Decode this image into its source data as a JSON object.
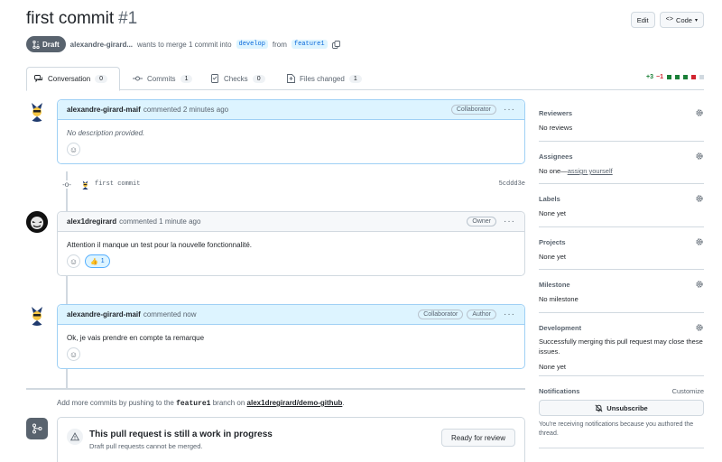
{
  "header": {
    "title": "first commit",
    "number": "#1",
    "edit_label": "Edit",
    "code_label": "Code"
  },
  "subtitle": {
    "badge": "Draft",
    "author": "alexandre-girard...",
    "text_merge": "wants to merge 1 commit into",
    "base_branch": "develop",
    "text_from": "from",
    "head_branch": "feature1"
  },
  "tabs": [
    {
      "label": "Conversation",
      "count": "0"
    },
    {
      "label": "Commits",
      "count": "1"
    },
    {
      "label": "Checks",
      "count": "0"
    },
    {
      "label": "Files changed",
      "count": "1"
    }
  ],
  "diffstat": {
    "additions": "+3",
    "deletions": "−1"
  },
  "comments": [
    {
      "author": "alexandre-girard-maif",
      "time": "commented 2 minutes ago",
      "role": "Collaborator",
      "body": "No description provided."
    },
    {
      "author": "alex1dregirard",
      "time": "commented 1 minute ago",
      "role": "Owner",
      "body": "Attention il manque un test pour la nouvelle fonctionnalité.",
      "reaction_count": "1"
    },
    {
      "author": "alexandre-girard-maif",
      "time": "commented now",
      "role": "Collaborator",
      "role2": "Author",
      "body": "Ok, je vais prendre en compte ta remarque"
    }
  ],
  "commit": {
    "message": "first commit",
    "sha": "5cddd3e"
  },
  "push_info": {
    "prefix": "Add more commits by pushing to the",
    "branch": "feature1",
    "middle": "branch on",
    "repo": "alex1dregirard/demo-github",
    "suffix": "."
  },
  "wip": {
    "title": "This pull request is still a work in progress",
    "subtitle": "Draft pull requests cannot be merged.",
    "button": "Ready for review"
  },
  "sidebar": {
    "reviewers": {
      "label": "Reviewers",
      "value": "No reviews"
    },
    "assignees": {
      "label": "Assignees",
      "value_prefix": "No one—",
      "link": "assign yourself"
    },
    "labels": {
      "label": "Labels",
      "value": "None yet"
    },
    "projects": {
      "label": "Projects",
      "value": "None yet"
    },
    "milestone": {
      "label": "Milestone",
      "value": "No milestone"
    },
    "development": {
      "label": "Development",
      "text": "Successfully merging this pull request may close these issues.",
      "value": "None yet"
    },
    "notifications": {
      "label": "Notifications",
      "customize": "Customize",
      "button": "Unsubscribe",
      "note": "You're receiving notifications because you authored the thread."
    }
  },
  "colors": {
    "draft_badge": "#59636e",
    "highlight_border": "#9fd0f5",
    "highlight_bg": "#ddf4ff",
    "additions": "#1a7f37",
    "deletions": "#d1242f"
  }
}
